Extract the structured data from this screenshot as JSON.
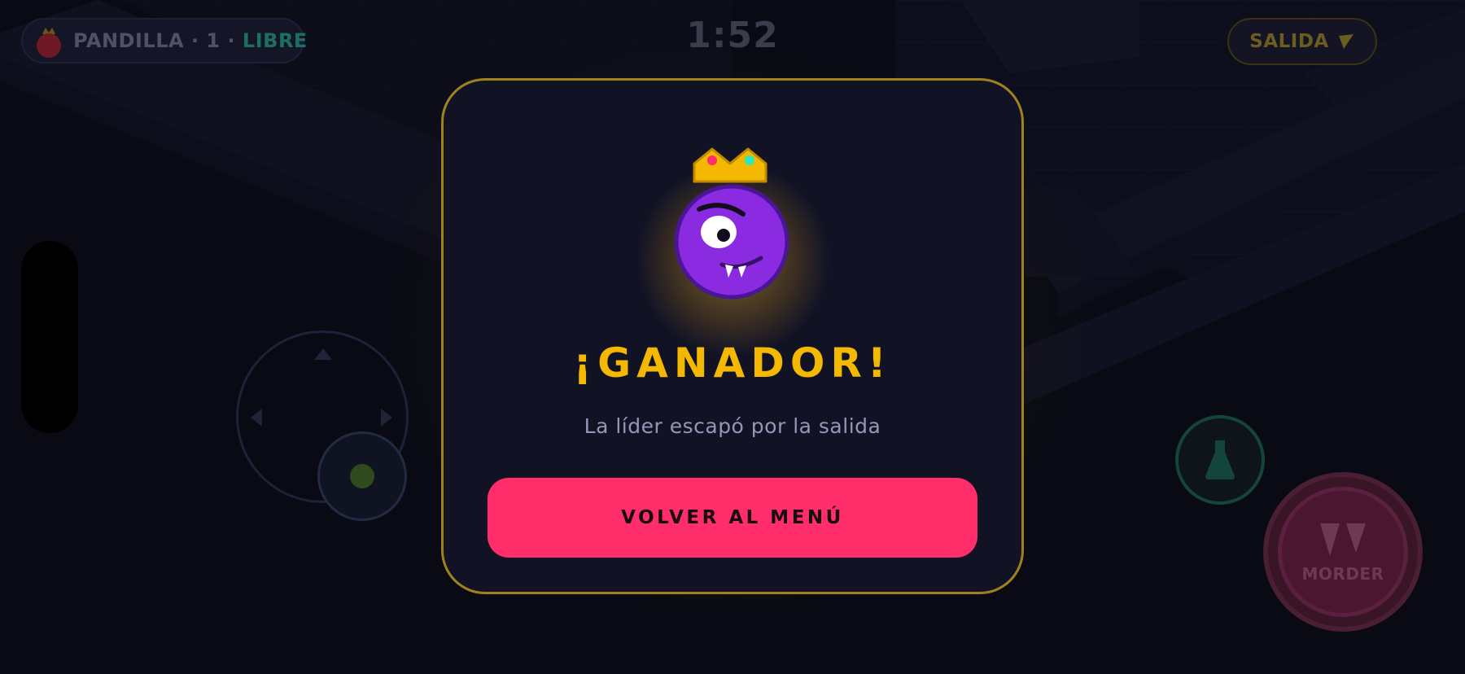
{
  "hud": {
    "team_label": "PANDILLA · 1 · ",
    "mode_label": "LIBRE",
    "timer": "1:52",
    "exit_label": "SALIDA"
  },
  "modal": {
    "title": "¡GANADOR!",
    "subtitle": "La líder escapó por la salida",
    "button_label": "VOLVER AL MENÚ"
  },
  "controls": {
    "bite_label": "MORDER"
  },
  "colors": {
    "accent_gold": "#f5b800",
    "button_pink": "#ff2d6a",
    "avatar_purple": "#8a2be2",
    "mode_teal": "#1d6f62"
  }
}
